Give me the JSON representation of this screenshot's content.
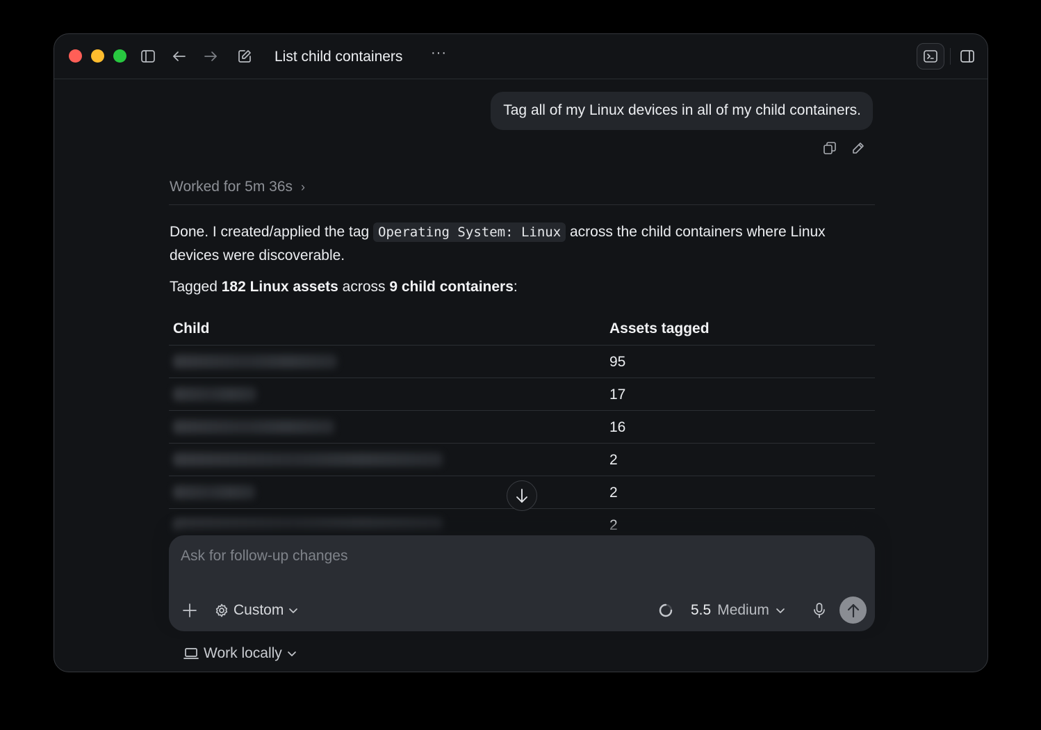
{
  "window": {
    "title": "List child containers",
    "more_label": "···",
    "traffic_colors": {
      "close": "#ff5f57",
      "minimize": "#febc2e",
      "zoom": "#28c840"
    }
  },
  "toolbar_icons": [
    "sidebar-toggle-icon",
    "back-arrow-icon",
    "forward-arrow-icon",
    "new-chat-icon",
    "terminal-icon",
    "right-panel-icon"
  ],
  "user_message": {
    "text": "Tag all of my Linux devices in all of my child containers.",
    "actions": [
      "copy-icon",
      "edit-icon"
    ]
  },
  "assistant": {
    "worked_label": "Worked for 5m 36s",
    "para1_before": "Done. I created/applied the tag ",
    "para1_code": "Operating System: Linux",
    "para1_after": " across the child containers where Linux devices were discoverable.",
    "para2_a": "Tagged ",
    "para2_b": "182 Linux assets",
    "para2_c": " across ",
    "para2_d": "9 child containers",
    "para2_e": ":"
  },
  "table": {
    "headers": [
      "Child",
      "Assets tagged"
    ],
    "rows": [
      {
        "child": "",
        "assets": "95"
      },
      {
        "child": "",
        "assets": "17"
      },
      {
        "child": "",
        "assets": "16"
      },
      {
        "child": "",
        "assets": "2"
      },
      {
        "child": "",
        "assets": "2"
      },
      {
        "child": "",
        "assets": "2"
      }
    ]
  },
  "composer": {
    "placeholder": "Ask for follow-up changes",
    "mode_label": "Custom",
    "model_version": "5.5",
    "model_level": "Medium"
  },
  "footer": {
    "work_location": "Work locally"
  },
  "accent": {
    "send_button": "#8a8d93",
    "background": "#121417"
  }
}
